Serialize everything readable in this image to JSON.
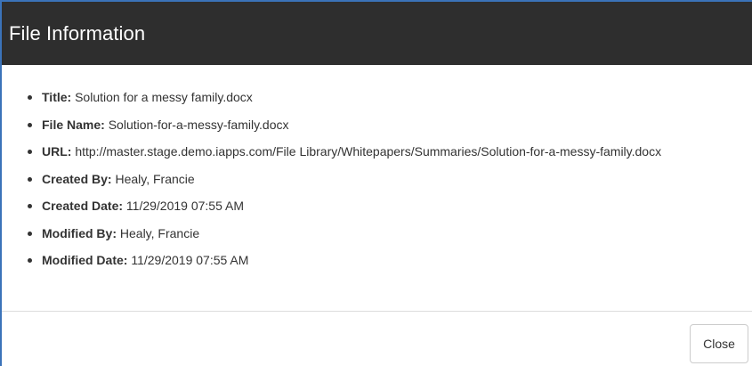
{
  "dialog": {
    "title": "File Information"
  },
  "file_info": {
    "items": [
      {
        "label": "Title:",
        "value": "Solution for a messy family.docx"
      },
      {
        "label": "File Name:",
        "value": "Solution-for-a-messy-family.docx"
      },
      {
        "label": "URL:",
        "value": "http://master.stage.demo.iapps.com/File Library/Whitepapers/Summaries/Solution-for-a-messy-family.docx"
      },
      {
        "label": "Created By:",
        "value": "Healy, Francie"
      },
      {
        "label": "Created Date:",
        "value": "11/29/2019 07:55 AM"
      },
      {
        "label": "Modified By:",
        "value": "Healy, Francie"
      },
      {
        "label": "Modified Date:",
        "value": "11/29/2019 07:55 AM"
      }
    ]
  },
  "footer": {
    "close_label": "Close"
  },
  "colors": {
    "header_bg": "#2e2e2e",
    "header_text": "#ffffff",
    "border_accent": "#3b73b9"
  }
}
